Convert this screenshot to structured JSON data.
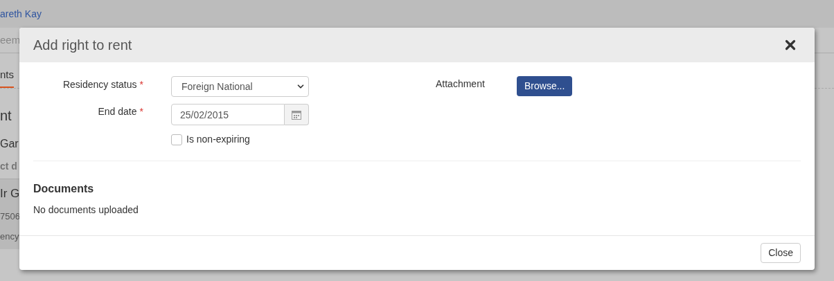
{
  "background": {
    "user_link": "areth Kay",
    "nav_text": "eem",
    "tab": {
      "label": "nts",
      "selected": true
    },
    "heading": "nt",
    "name": "Gar",
    "section_label": "ct d",
    "card_lines": [
      "Ir G",
      "7506",
      "ency"
    ]
  },
  "dialog": {
    "title": "Add right to rent",
    "fields": [
      {
        "kind": "select",
        "label": "Residency status",
        "required_mark": "*",
        "value": "Foreign National"
      },
      {
        "kind": "date",
        "label": "End date",
        "required_mark": "*",
        "value": "25/02/2015"
      },
      {
        "kind": "checkbox",
        "label": "Is non-expiring",
        "checked": false
      }
    ],
    "attachment": {
      "label": "Attachment",
      "button": "Browse..."
    },
    "documents": {
      "title": "Documents",
      "empty_text": "No documents uploaded"
    },
    "footer_button": "Close"
  }
}
